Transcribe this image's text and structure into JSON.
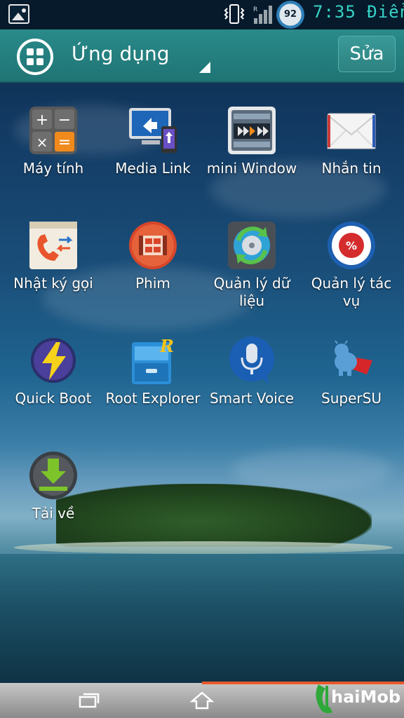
{
  "status_bar": {
    "battery_level": "92",
    "time": "7:35",
    "carrier": "Điển",
    "icons": [
      "image-notification-icon",
      "vibrate-icon",
      "signal-icon",
      "battery-icon"
    ]
  },
  "action_bar": {
    "title": "Ứng dụng",
    "edit_label": "Sửa"
  },
  "apps": [
    {
      "label": "Máy tính",
      "icon": "calculator-icon"
    },
    {
      "label": "Media Link",
      "icon": "media-link-icon"
    },
    {
      "label": "mini Window",
      "icon": "mini-window-icon"
    },
    {
      "label": "Nhắn tin",
      "icon": "messages-icon"
    },
    {
      "label": "Nhật ký gọi",
      "icon": "call-log-icon"
    },
    {
      "label": "Phim",
      "icon": "film-icon"
    },
    {
      "label": "Quản lý dữ liệu",
      "icon": "data-manager-icon"
    },
    {
      "label": "Quản lý tác vụ",
      "icon": "task-manager-icon"
    },
    {
      "label": "Quick Boot",
      "icon": "quick-boot-icon"
    },
    {
      "label": "Root Explorer",
      "icon": "root-explorer-icon"
    },
    {
      "label": "Smart Voice",
      "icon": "smart-voice-icon"
    },
    {
      "label": "SuperSU",
      "icon": "supersu-icon"
    },
    {
      "label": "Tải về",
      "icon": "downloads-icon"
    }
  ],
  "watermark": {
    "text": "haiMobile",
    "icon": "thaimobile-logo"
  },
  "colors": {
    "action_bar": "#207474",
    "status_text": "#36d4c6",
    "nav_progress": "#e8582b"
  }
}
